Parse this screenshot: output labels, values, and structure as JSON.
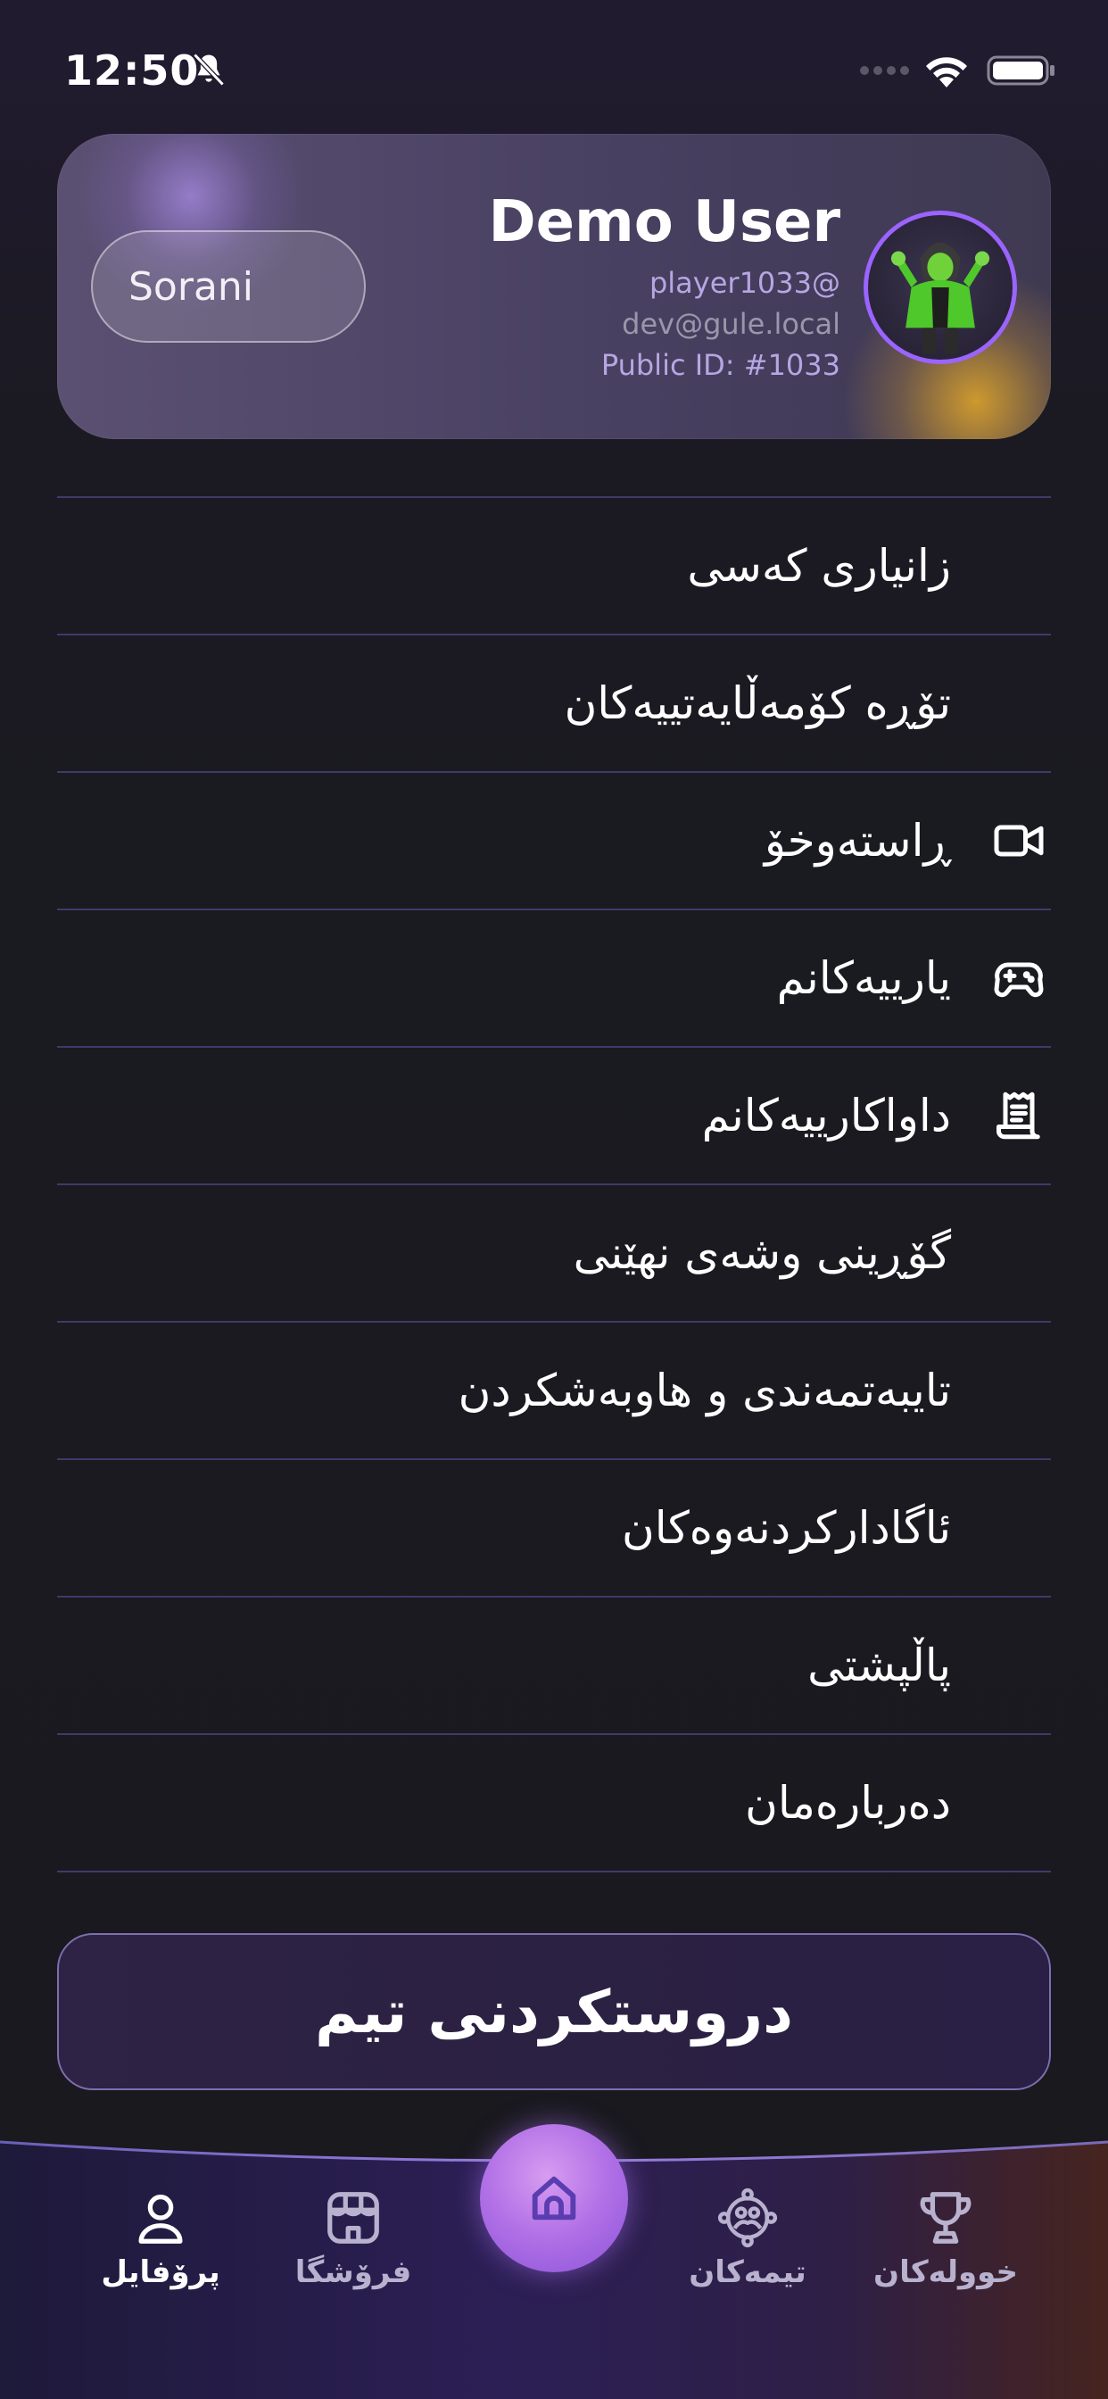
{
  "status_bar": {
    "time": "12:50"
  },
  "profile": {
    "language": "Sorani",
    "name": "Demo User",
    "handle": "player1033@",
    "email": "dev@gule.local",
    "public_id": "Public ID: #1033"
  },
  "menu": {
    "items": [
      {
        "label": "زانیاری کەسی",
        "icon": ""
      },
      {
        "label": "تۆڕە کۆمەڵایەتییەکان",
        "icon": ""
      },
      {
        "label": "ڕاستەوخۆ",
        "icon": "video-camera-icon"
      },
      {
        "label": "یارییەکانم",
        "icon": "gamepad-icon"
      },
      {
        "label": "داواکارییەکانم",
        "icon": "receipt-icon"
      },
      {
        "label": "گۆڕینی وشەی نهێنی",
        "icon": ""
      },
      {
        "label": "تایبەتمەندی و هاوبەشکردن",
        "icon": ""
      },
      {
        "label": "ئاگادارکردنەوەکان",
        "icon": ""
      },
      {
        "label": "پاڵپشتی",
        "icon": ""
      },
      {
        "label": "دەربارەمان",
        "icon": ""
      }
    ]
  },
  "create_team": {
    "label": "دروستکردنی تیم"
  },
  "bottom_nav": {
    "profile": "پرۆفایل",
    "shop": "فرۆشگا",
    "teams": "تیمەکان",
    "tournaments": "خوولەکان"
  },
  "colors": {
    "accent": "#9b64ff",
    "divider": "#3f3a6a",
    "muted_text": "#b6a6e3"
  }
}
